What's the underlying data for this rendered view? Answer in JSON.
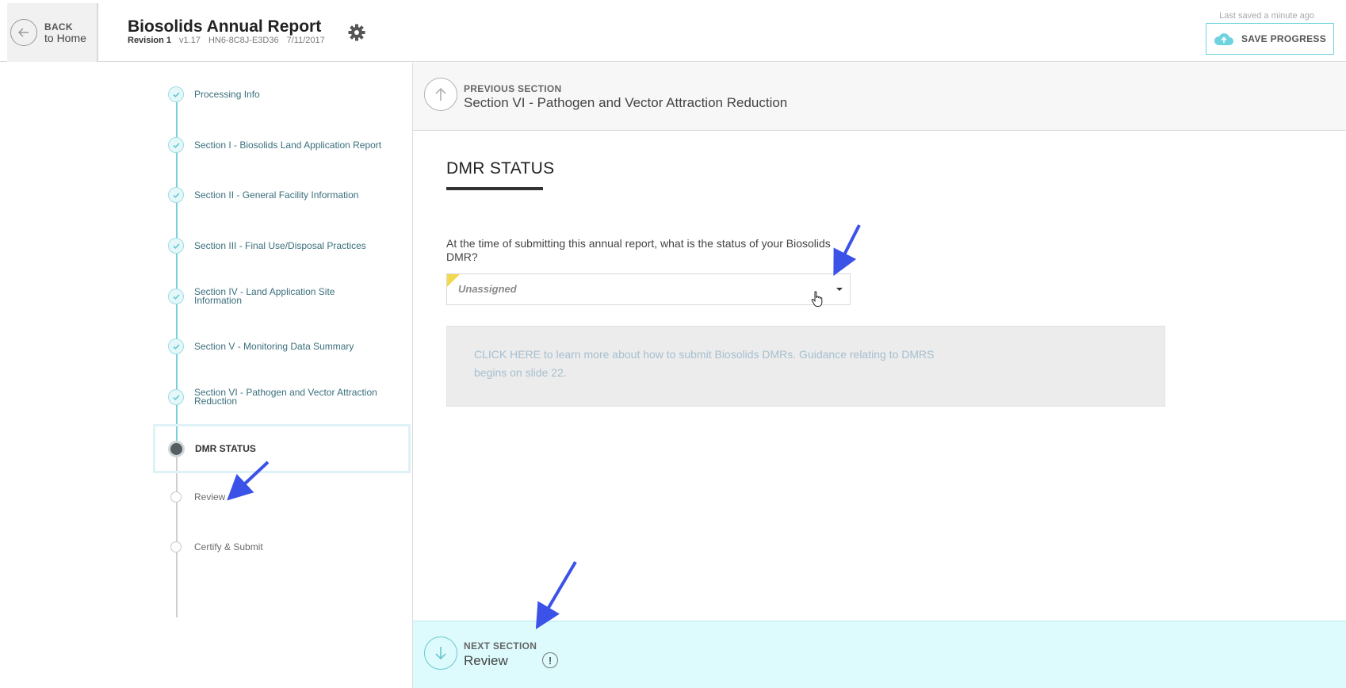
{
  "header": {
    "back_line1": "BACK",
    "back_line2": "to Home",
    "title": "Biosolids Annual Report",
    "revision": "Revision 1",
    "version": "v1.17",
    "code": "HN6-8C8J-E3D36",
    "date": "7/11/2017",
    "saved_status": "Last saved a minute ago",
    "save_label": "SAVE PROGRESS",
    "icons": {
      "back": "arrow-left-icon",
      "settings": "gear-icon",
      "save": "cloud-upload-icon"
    },
    "accent_color": "#6fd3df"
  },
  "nav": {
    "steps": [
      {
        "label": "Processing Info",
        "state": "done"
      },
      {
        "label": "Section I - Biosolids Land Application Report",
        "state": "done"
      },
      {
        "label": "Section II - General Facility Information",
        "state": "done"
      },
      {
        "label": "Section III - Final Use/Disposal Practices",
        "state": "done"
      },
      {
        "label": "Section IV - Land Application Site Information",
        "state": "done"
      },
      {
        "label": "Section V - Monitoring Data Summary",
        "state": "done"
      },
      {
        "label": "Section VI - Pathogen and Vector Attraction Reduction",
        "state": "done"
      },
      {
        "label": "DMR STATUS",
        "state": "current"
      },
      {
        "label": "Review",
        "state": "todo"
      },
      {
        "label": "Certify & Submit",
        "state": "todo"
      }
    ]
  },
  "main": {
    "prev_small": "PREVIOUS SECTION",
    "prev_title": "Section VI - Pathogen and Vector Attraction Reduction",
    "heading": "DMR STATUS",
    "question": "At the time of submitting this annual report, what is the status of your Biosolids DMR?",
    "select_value": "Unassigned",
    "guide_link": "CLICK HERE",
    "guide_text": " to learn more about how to submit Biosolids DMRs. Guidance relating to DMRS begins on slide 22.",
    "next_small": "NEXT SECTION",
    "next_title": "Review",
    "warn_glyph": "!"
  }
}
